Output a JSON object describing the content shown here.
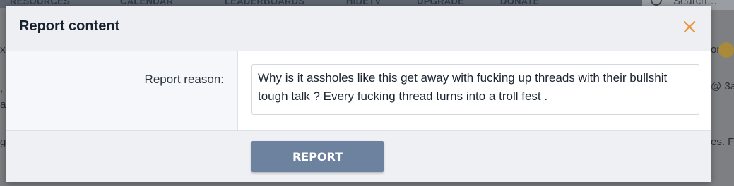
{
  "background": {
    "nav_items": [
      "RESOURCES",
      "CALENDAR",
      "LEADERBOARDS",
      "HIDETV",
      "UPGRADE",
      "DONATE"
    ],
    "search_placeholder": "Search…",
    "fragments": {
      "right_1": "on.",
      "right_2": "@ 3a",
      "right_3": "es. F",
      "left_1": "x",
      "left_2": ",",
      "left_3": "a",
      "left_4": "g"
    }
  },
  "modal": {
    "title": "Report content",
    "close_icon": "close-icon",
    "field_label": "Report reason:",
    "reason_text": "Why is it assholes like this get away with fucking up threads with their bullshit tough talk ? Every fucking thread turns into a troll fest .",
    "submit_label": "REPORT"
  },
  "colors": {
    "accent_close": "#e8943a",
    "button_bg": "#6c829e",
    "overlay": "#7d7f82"
  }
}
